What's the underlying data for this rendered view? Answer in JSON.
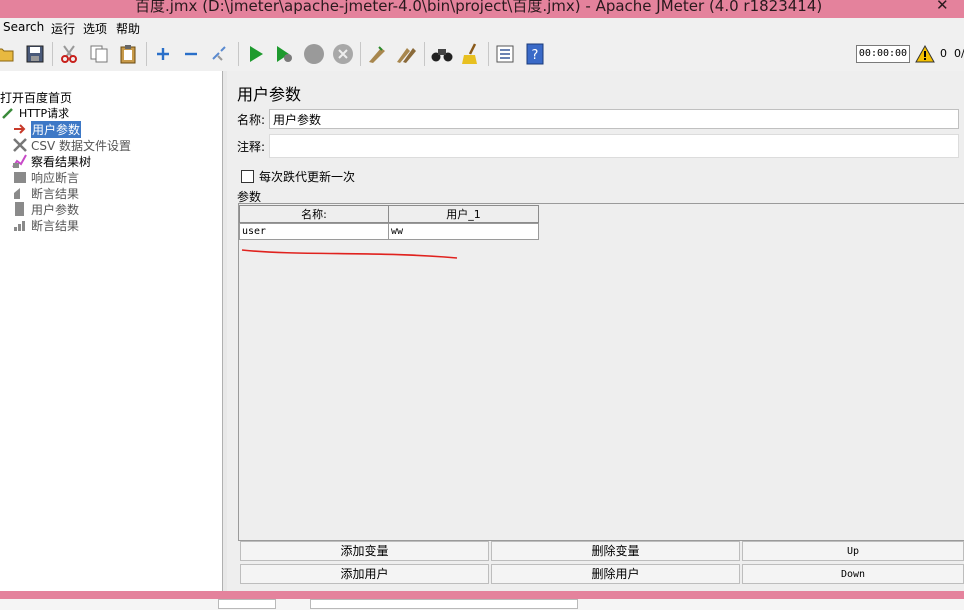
{
  "window": {
    "title": "百度.jmx (D:\\jmeter\\apache-jmeter-4.0\\bin\\project\\百度.jmx) - Apache JMeter (4.0 r1823414)",
    "close_glyph": "✕"
  },
  "menu": [
    "Search",
    "运行",
    "选项",
    "帮助"
  ],
  "toolbar": {
    "timer": "00:00:00",
    "warning_count": "0",
    "extra_count": "0/"
  },
  "tree": [
    {
      "label": "打开百度首页",
      "icon": "test-plan-icon"
    },
    {
      "label": "HTTP请求",
      "icon": "http-sampler-icon"
    },
    {
      "label": "用户参数",
      "icon": "user-params-icon",
      "selected": true
    },
    {
      "label": "CSV 数据文件设置",
      "icon": "tools-icon"
    },
    {
      "label": "察看结果树",
      "icon": "results-tree-icon"
    },
    {
      "label": "响应断言",
      "icon": "assertion-icon"
    },
    {
      "label": "断言结果",
      "icon": "assertion-results-icon"
    },
    {
      "label": "用户参数",
      "icon": "user-params2-icon"
    },
    {
      "label": "断言结果",
      "icon": "graph-icon"
    }
  ],
  "panel": {
    "title": "用户参数",
    "name_label": "名称:",
    "name_value": "用户参数",
    "comment_label": "注释:",
    "comment_value": "",
    "checkbox_label": "每次跌代更新一次",
    "checkbox_checked": false,
    "params_label": "参数",
    "table": {
      "headers": [
        "名称:",
        "用户_1"
      ],
      "rows": [
        [
          "user",
          "ww"
        ]
      ]
    },
    "buttons": {
      "add_variable": "添加变量",
      "delete_variable": "删除变量",
      "up": "Up",
      "add_user": "添加用户",
      "delete_user": "删除用户",
      "down": "Down"
    }
  },
  "colors": {
    "titlebar": "#e4829c",
    "selection": "#3d78c6",
    "annotation_red": "#e0221e"
  }
}
